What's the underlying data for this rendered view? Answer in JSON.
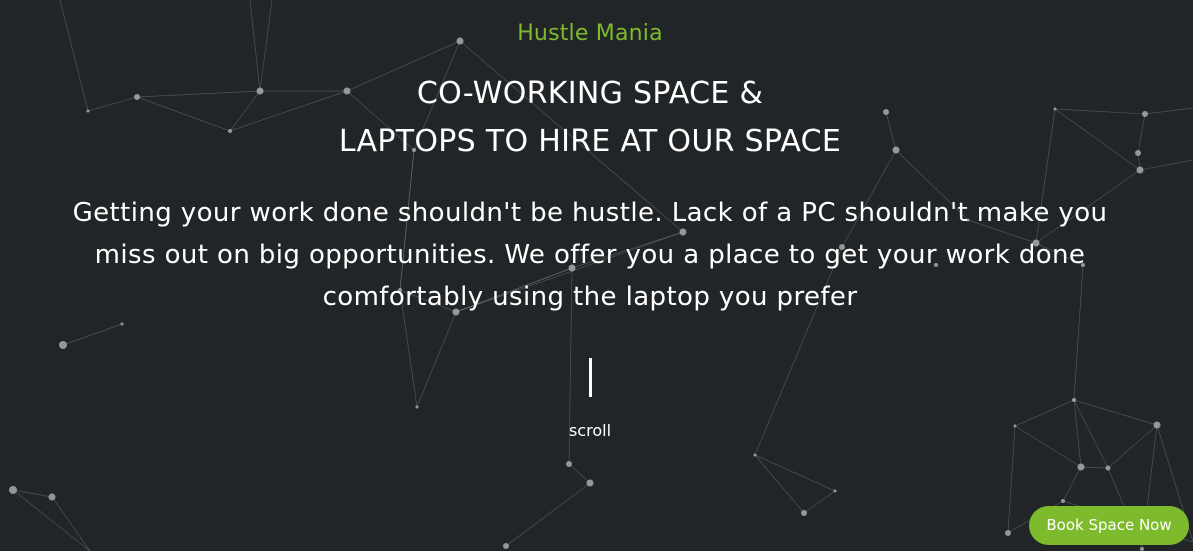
{
  "brand": {
    "name": "Hustle Mania",
    "color": "#7dbb2c"
  },
  "hero": {
    "headline_line1": "CO-WORKING SPACE &",
    "headline_line2": "LAPTOPS TO HIRE AT OUR SPACE",
    "tagline": "Getting your work done shouldn't be hustle. Lack of a PC shouldn't make you miss out on big opportunities. We offer you a place to get your work done comfortably using the laptop you prefer",
    "scroll_label": "scroll"
  },
  "cta": {
    "label": "Book Space Now"
  },
  "background": {
    "color": "#222527",
    "node_color": "#a9a9a9",
    "line_color": "#8a8a8a"
  }
}
